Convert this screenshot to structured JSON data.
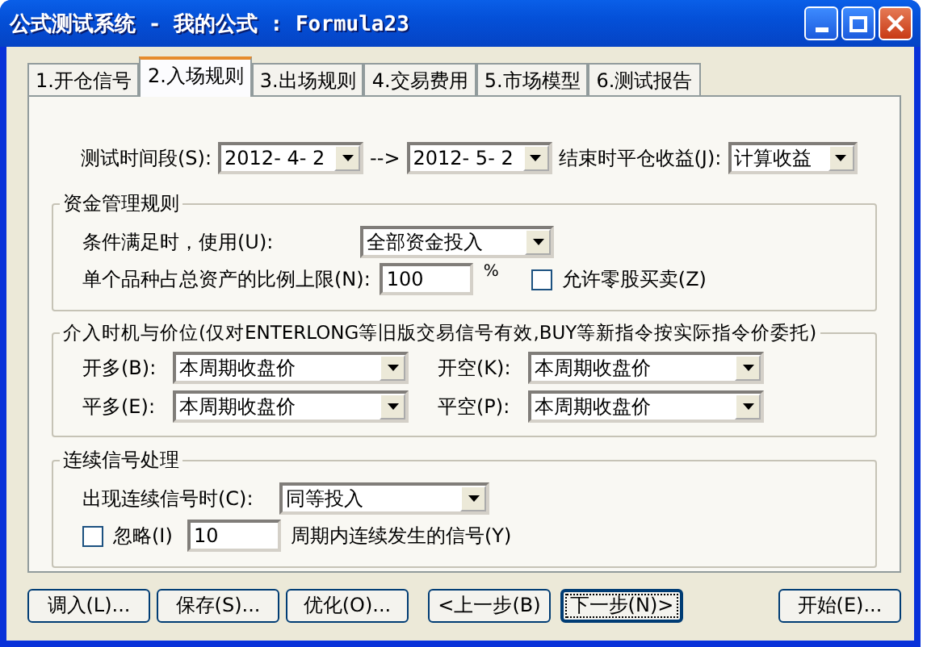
{
  "window": {
    "title": "公式测试系统 - 我的公式 : Formula23"
  },
  "tabs": [
    {
      "label": "1.开仓信号",
      "selected": false
    },
    {
      "label": "2.入场规则",
      "selected": true
    },
    {
      "label": "3.出场规则",
      "selected": false
    },
    {
      "label": "4.交易费用",
      "selected": false
    },
    {
      "label": "5.市场模型",
      "selected": false
    },
    {
      "label": "6.测试报告",
      "selected": false
    }
  ],
  "test_period": {
    "label": "测试时间段(S):",
    "start": "2012- 4- 2",
    "arrow": "-->",
    "end": "2012- 5- 2"
  },
  "close_profit": {
    "label": "结束时平仓收益(J):",
    "value": "计算收益"
  },
  "money_management": {
    "title": "资金管理规则",
    "use_label": "条件满足时，使用(U):",
    "use_value": "全部资金投入",
    "limit_label": "单个品种占总资产的比例上限(N):",
    "limit_value": "100",
    "limit_unit": "%",
    "odd_lot": {
      "label": "允许零股买卖(Z)",
      "checked": false
    }
  },
  "entry_price": {
    "title": "介入时机与价位(仅对ENTERLONG等旧版交易信号有效,BUY等新指令按实际指令价委托)",
    "fields": [
      {
        "label": "开多(B):",
        "value": "本周期收盘价"
      },
      {
        "label": "开空(K):",
        "value": "本周期收盘价"
      },
      {
        "label": "平多(E):",
        "value": "本周期收盘价"
      },
      {
        "label": "平空(P):",
        "value": "本周期收盘价"
      }
    ]
  },
  "consecutive": {
    "title": "连续信号处理",
    "when_label": "出现连续信号时(C):",
    "when_value": "同等投入",
    "ignore": {
      "label": "忽略(I)",
      "checked": false,
      "value": "10",
      "suffix": "周期内连续发生的信号(Y)"
    }
  },
  "button_groups": [
    [
      {
        "label": "调入(L)...",
        "default": false
      },
      {
        "label": "保存(S)...",
        "default": false
      },
      {
        "label": "优化(O)...",
        "default": false
      }
    ],
    [
      {
        "label": "<上一步(B)",
        "default": false
      },
      {
        "label": "下一步(N)>",
        "default": true
      }
    ],
    [
      {
        "label": "开始(E)...",
        "default": false
      }
    ]
  ]
}
